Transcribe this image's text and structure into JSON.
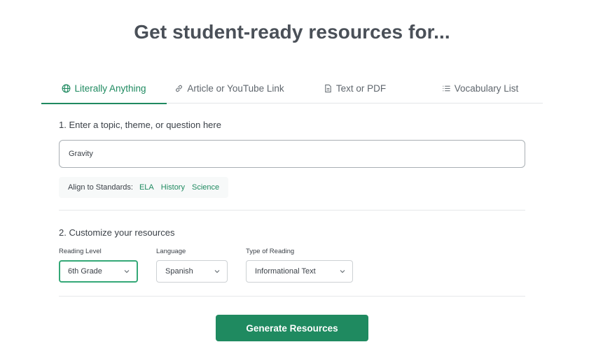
{
  "page": {
    "title": "Get student-ready resources for..."
  },
  "tabs": [
    {
      "label": "Literally Anything",
      "icon": "globe-icon",
      "active": true
    },
    {
      "label": "Article or YouTube Link",
      "icon": "link-icon",
      "active": false
    },
    {
      "label": "Text or PDF",
      "icon": "document-icon",
      "active": false
    },
    {
      "label": "Vocabulary List",
      "icon": "list-icon",
      "active": false
    }
  ],
  "step1": {
    "label": "1. Enter a topic, theme, or question here",
    "topic_value": "Gravity",
    "standards_label": "Align to Standards:",
    "standards": [
      "ELA",
      "History",
      "Science"
    ]
  },
  "step2": {
    "label": "2. Customize your resources",
    "reading_level": {
      "label": "Reading Level",
      "value": "6th Grade"
    },
    "language": {
      "label": "Language",
      "value": "Spanish"
    },
    "reading_type": {
      "label": "Type of Reading",
      "value": "Informational Text"
    }
  },
  "actions": {
    "generate_label": "Generate Resources"
  },
  "colors": {
    "accent": "#1f8a60",
    "focus_border": "#34a877",
    "text": "#3b4148"
  }
}
